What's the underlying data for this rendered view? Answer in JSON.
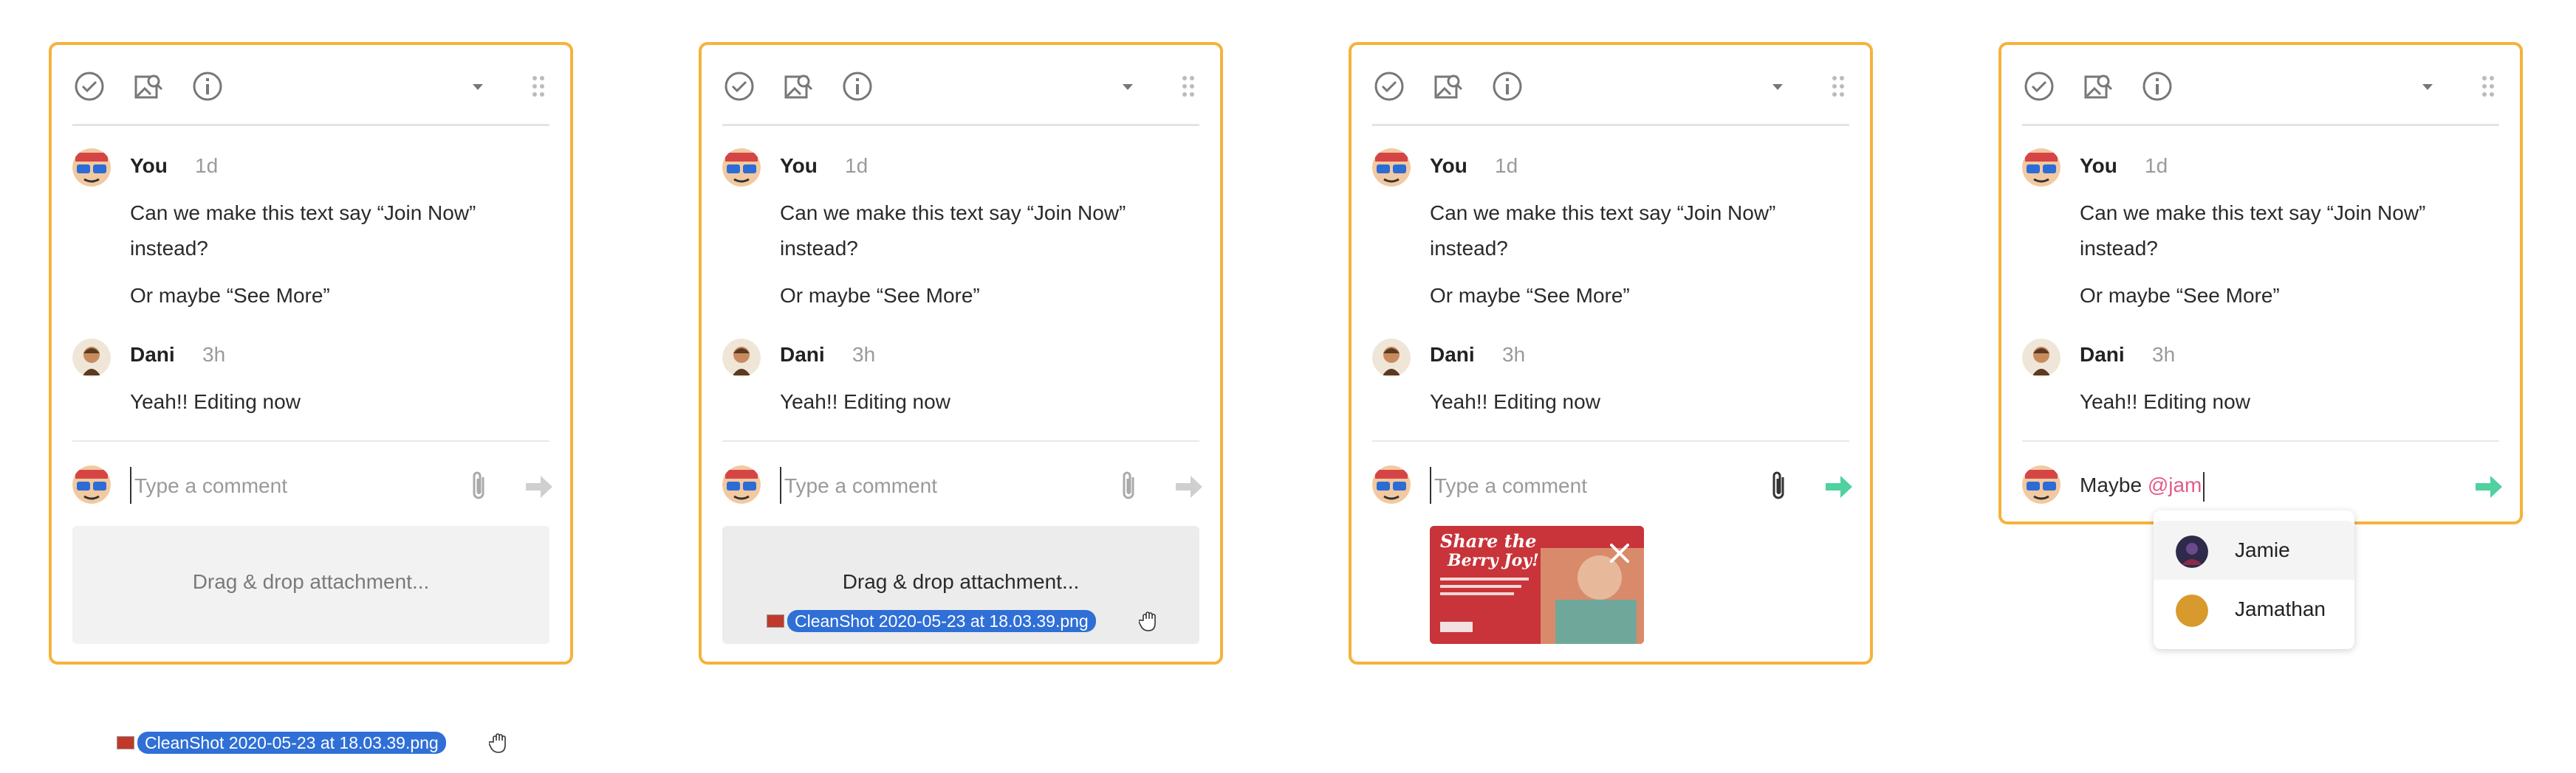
{
  "toolbar": {
    "icons": [
      "check-circle-icon",
      "image-search-icon",
      "info-icon",
      "caret-down-icon",
      "drag-grip-icon"
    ]
  },
  "thread": {
    "you_name": "You",
    "you_time": "1d",
    "you_msg_line1": "Can we make this text say “Join Now”",
    "you_msg_line2": "instead?",
    "you_msg_line3": "Or maybe “See More”",
    "dani_name": "Dani",
    "dani_time": "3h",
    "dani_msg": "Yeah!! Editing now"
  },
  "composer": {
    "placeholder": "Type a comment",
    "typed_prefix": "Maybe ",
    "typed_mention": "@jam"
  },
  "dropzone": {
    "label": "Drag & drop attachment..."
  },
  "dragged_file": {
    "name": "CleanShot 2020-05-23 at 18.03.39.png"
  },
  "attachment_preview": {
    "headline_line1": "Share the",
    "headline_line2": "Berry Joy!"
  },
  "mention_suggestions": [
    {
      "name": "Jamie"
    },
    {
      "name": "Jamathan"
    }
  ],
  "colors": {
    "panel_border": "#f6b23c",
    "send_active": "#4fd1a0",
    "send_inactive": "#cfcfcf",
    "mention": "#e45b8a",
    "file_chip": "#2f6fd6"
  }
}
